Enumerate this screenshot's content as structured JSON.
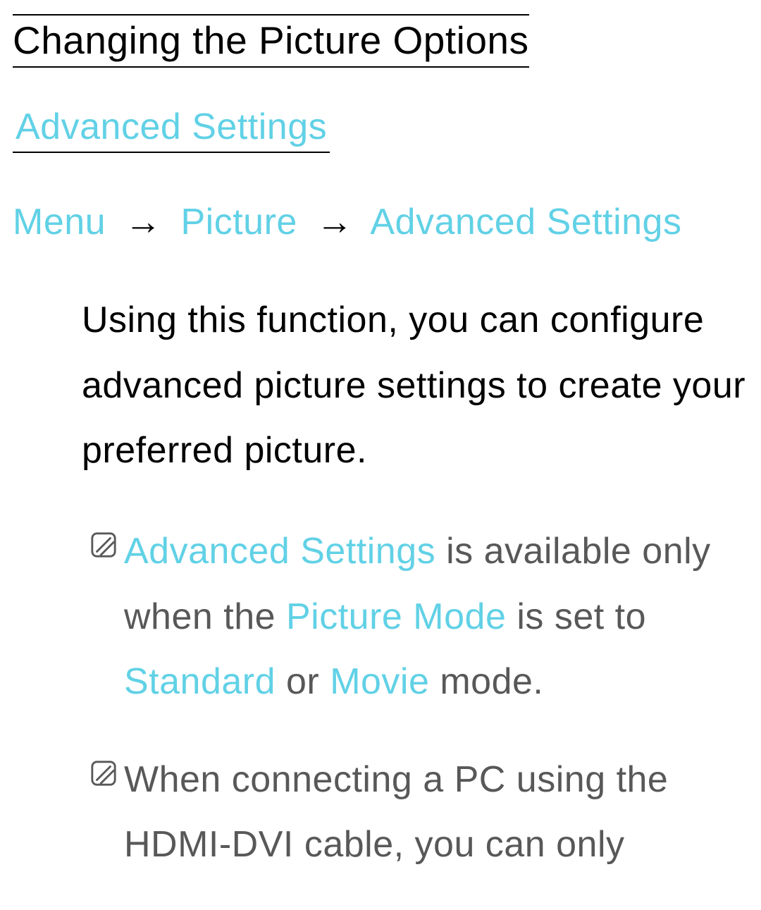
{
  "title": "Changing the Picture Options",
  "section_heading": "Advanced Settings",
  "breadcrumb": {
    "item1": "Menu",
    "item2": "Picture",
    "item3": "Advanced Settings",
    "separator": "→"
  },
  "body_paragraph": "Using this function, you can configure advanced picture settings to create your preferred picture.",
  "notes": [
    {
      "parts": {
        "hl1": "Advanced Settings",
        "t1": " is available only when the ",
        "hl2": "Picture Mode",
        "t2": " is set to ",
        "hl3": "Standard",
        "t3": " or ",
        "hl4": "Movie",
        "t4": " mode."
      }
    },
    {
      "parts": {
        "t1": "When connecting a PC using the HDMI-DVI cable, you can only"
      }
    }
  ],
  "icons": {
    "note": "note-icon"
  },
  "colors": {
    "accent": "#61d1e6",
    "body_gray": "#585858"
  }
}
